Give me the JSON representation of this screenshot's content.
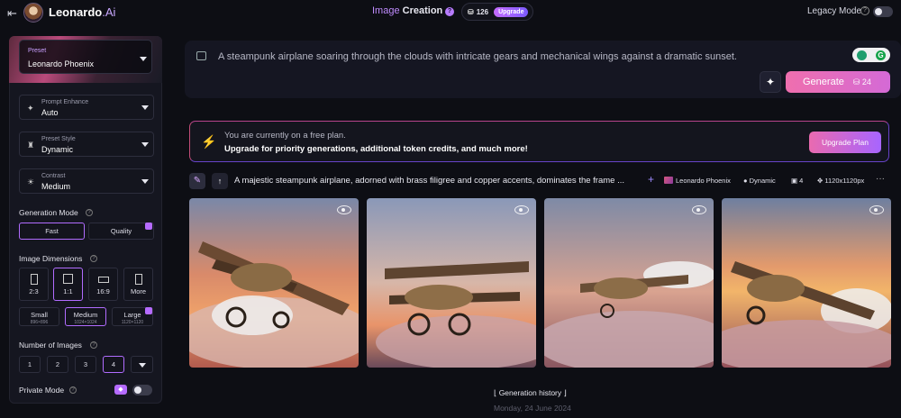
{
  "topbar": {
    "brand_name": "Leonardo",
    "brand_suffix": ".Ai",
    "title_accent": "Image",
    "title_rest": "Creation",
    "help_glyph": "?",
    "tokens": "126",
    "upgrade_label": "Upgrade",
    "legacy_label": "Legacy Mode",
    "legacy_on": false
  },
  "sidebar": {
    "preset": {
      "label": "Preset",
      "value": "Leonardo Phoenix"
    },
    "prompt_enhance": {
      "label": "Prompt Enhance",
      "value": "Auto"
    },
    "preset_style": {
      "label": "Preset Style",
      "value": "Dynamic"
    },
    "contrast": {
      "label": "Contrast",
      "value": "Medium"
    },
    "generation_mode": {
      "title": "Generation Mode",
      "options": [
        "Fast",
        "Quality"
      ],
      "selected": "Fast"
    },
    "image_dimensions": {
      "title": "Image Dimensions",
      "ratios": [
        "2:3",
        "1:1",
        "16:9",
        "More"
      ],
      "selected_ratio": "1:1",
      "sizes": [
        {
          "label": "Small",
          "sub": "896×896"
        },
        {
          "label": "Medium",
          "sub": "1024×1024"
        },
        {
          "label": "Large",
          "sub": "1120×1120"
        }
      ],
      "selected_size": "Medium"
    },
    "number_of_images": {
      "title": "Number of Images",
      "options": [
        "1",
        "2",
        "3",
        "4"
      ],
      "selected": "4"
    },
    "private_mode": {
      "title": "Private Mode",
      "on": false
    }
  },
  "prompt": {
    "text": "A steampunk airplane soaring through the clouds with intricate gears and mechanical wings against a dramatic sunset.",
    "generate_label": "Generate",
    "generate_cost": "24"
  },
  "banner": {
    "line1": "You are currently on a free plan.",
    "line2": "Upgrade for priority generations, additional token credits, and much more!",
    "button": "Upgrade Plan"
  },
  "generation": {
    "prompt": "A majestic steampunk airplane, adorned with brass filigree and copper accents, dominates the frame ...",
    "model": "Leonardo Phoenix",
    "style": "Dynamic",
    "count": "4",
    "size": "1120x1120px"
  },
  "history": {
    "label": "Generation history",
    "date": "Monday, 24 June 2024"
  },
  "colors": {
    "accent": "#b16cff",
    "generate_start": "#ef6fae",
    "generate_end": "#d46ad6",
    "bg": "#0d0e14"
  }
}
